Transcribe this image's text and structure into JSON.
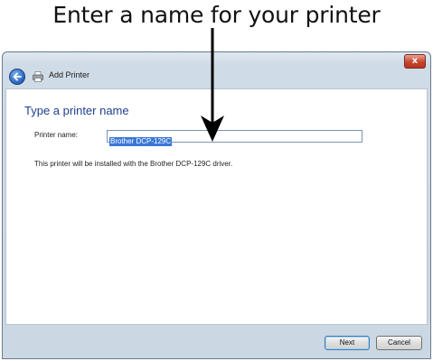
{
  "callout": {
    "text": "Enter a name for your printer"
  },
  "window": {
    "title": "Add Printer",
    "close_label": "x",
    "page_title": "Type a printer name",
    "printer_name_label": "Printer name:",
    "printer_name_value": "Brother DCP-129C",
    "info_text": "This printer will be installed with the Brother DCP-129C driver.",
    "next_label": "Next",
    "cancel_label": "Cancel"
  },
  "icons": {
    "back": "back-arrow-icon",
    "printer": "printer-icon",
    "close": "close-icon"
  },
  "colors": {
    "title_blue": "#1f3f8f",
    "selection": "#3a78d6",
    "close_red": "#c9442d"
  }
}
